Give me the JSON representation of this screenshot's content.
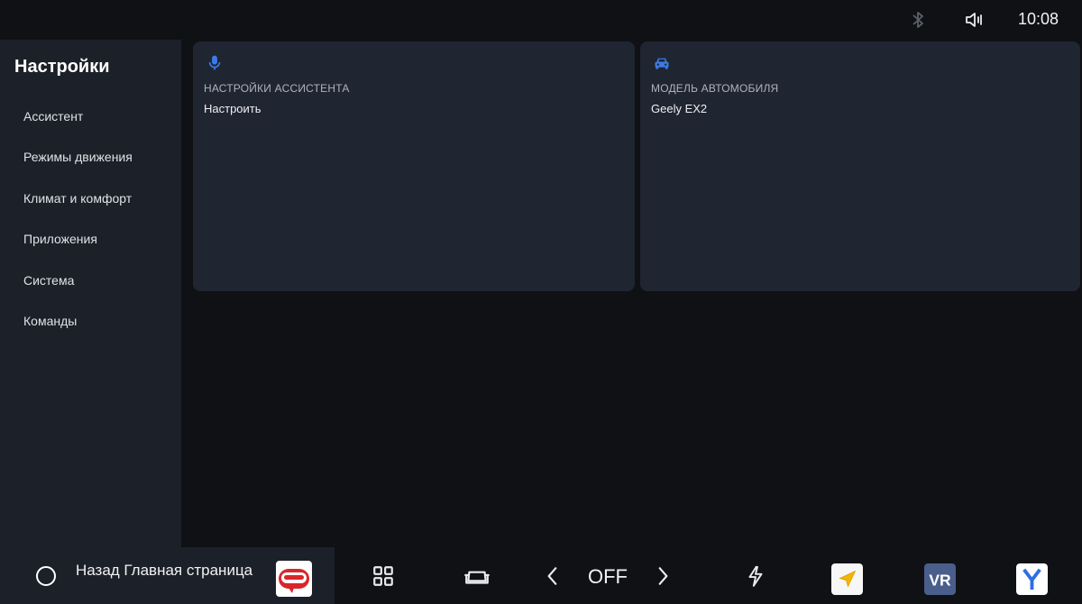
{
  "status": {
    "time": "10:08",
    "icons": [
      "bluetooth-icon",
      "volume-icon"
    ]
  },
  "sidebar": {
    "title": "Настройки",
    "items": [
      {
        "label": "Ассистент"
      },
      {
        "label": "Режимы движения"
      },
      {
        "label": "Климат и комфорт"
      },
      {
        "label": "Приложения"
      },
      {
        "label": "Система"
      },
      {
        "label": "Команды"
      }
    ]
  },
  "cards": [
    {
      "icon": "microphone-icon",
      "label": "НАСТРОЙКИ АССИСТЕНТА",
      "value": "Настроить"
    },
    {
      "icon": "car-icon",
      "label": "МОДЕЛЬ АВТОМОБИЛЯ",
      "value": "Geely EX2"
    }
  ],
  "taskbar": {
    "home_label": "Назад Главная страница",
    "climate_status": "OFF",
    "icons": [
      "home-circle-icon",
      "radio-logo",
      "apps-grid-icon",
      "seat-icon",
      "chevron-left-icon",
      "chevron-right-icon",
      "lightning-icon",
      "navigator-app-icon",
      "vr-app-icon",
      "yandex-app-icon"
    ]
  },
  "colors": {
    "accent": "#3b7be8",
    "background": "#0f1115",
    "panel": "#1c2028",
    "card": "#202532"
  }
}
